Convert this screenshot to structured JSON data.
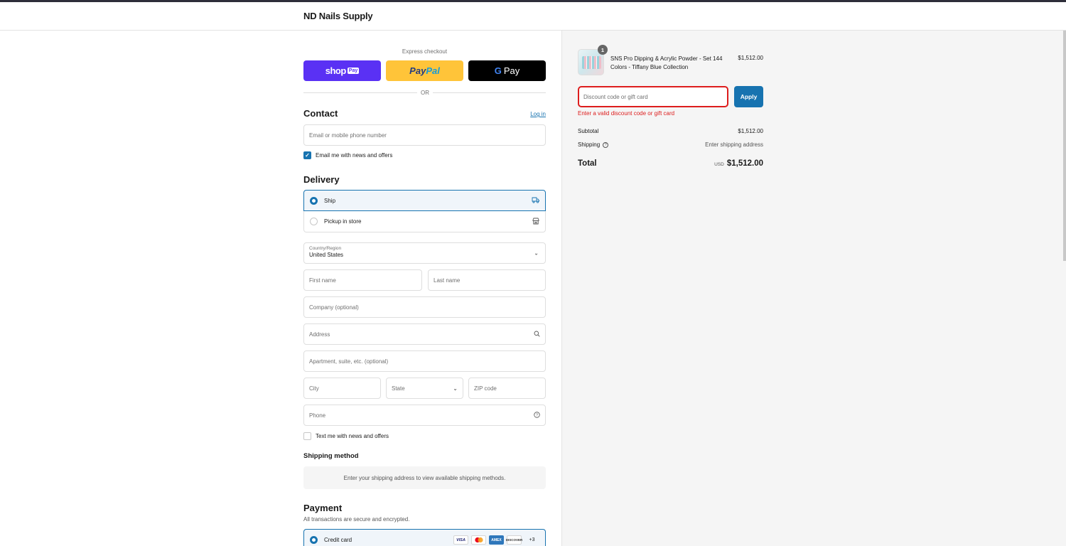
{
  "store": {
    "name": "ND Nails Supply"
  },
  "express": {
    "label": "Express checkout",
    "shop_pay": {
      "brand": "shop",
      "chip": "Pay"
    },
    "paypal": {
      "part1": "Pay",
      "part2": "Pal"
    },
    "gpay": {
      "g": "G",
      "text": "Pay"
    },
    "or": "OR"
  },
  "contact": {
    "title": "Contact",
    "login": "Log in",
    "email_placeholder": "Email or mobile phone number",
    "news_label": "Email me with news and offers",
    "news_checked": true
  },
  "delivery": {
    "title": "Delivery",
    "options": [
      {
        "label": "Ship",
        "icon": "truck-icon",
        "selected": true
      },
      {
        "label": "Pickup in store",
        "icon": "store-icon",
        "selected": false
      }
    ],
    "country_label": "Country/Region",
    "country_value": "United States",
    "first_name": "First name",
    "last_name": "Last name",
    "company": "Company (optional)",
    "address": "Address",
    "apartment": "Apartment, suite, etc. (optional)",
    "city": "City",
    "state": "State",
    "zip": "ZIP code",
    "phone": "Phone",
    "text_label": "Text me with news and offers"
  },
  "shipping_method": {
    "title": "Shipping method",
    "message": "Enter your shipping address to view available shipping methods."
  },
  "payment": {
    "title": "Payment",
    "subtitle": "All transactions are secure and encrypted.",
    "method": "Credit card",
    "cards": [
      "VISA",
      "Mastercard",
      "AMEX",
      "DISCOVER"
    ],
    "more": "+3"
  },
  "summary": {
    "item": {
      "name": "SNS Pro Dipping & Acrylic Powder - Set 144 Colors - Tiffany Blue Collection",
      "price": "$1,512.00",
      "qty": "1"
    },
    "discount_placeholder": "Discount code or gift card",
    "apply": "Apply",
    "error": "Enter a valid discount code or gift card",
    "subtotal_label": "Subtotal",
    "subtotal": "$1,512.00",
    "shipping_label": "Shipping",
    "shipping_value": "Enter shipping address",
    "total_label": "Total",
    "currency": "USD",
    "total": "$1,512.00"
  }
}
